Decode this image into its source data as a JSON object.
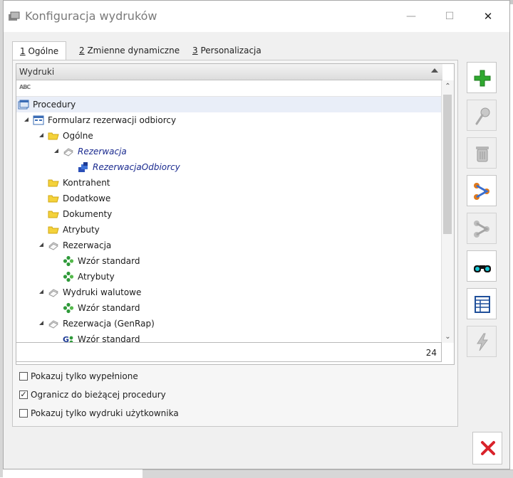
{
  "window": {
    "title": "Konfiguracja wydruków",
    "minimize_label": "—",
    "maximize_label": "☐",
    "close_label": "✕"
  },
  "tabs": [
    {
      "num": "1",
      "label": " Ogólne",
      "active": true
    },
    {
      "num": "2",
      "label": " Zmienne dynamiczne",
      "active": false
    },
    {
      "num": "3",
      "label": " Personalizacja",
      "active": false
    }
  ],
  "grid": {
    "header": "Wydruki",
    "filter_icon": "ABC",
    "rows": [
      {
        "label": "Procedury",
        "icon": "procedures-icon",
        "selected": true,
        "italic": false
      },
      {
        "label": "Formularz rezerwacji odbiorcy",
        "icon": "form-icon",
        "selected": false,
        "italic": false
      },
      {
        "label": "Ogólne",
        "icon": "folder-icon",
        "selected": false,
        "italic": false
      },
      {
        "label": "Rezerwacja",
        "icon": "document-icon",
        "selected": false,
        "italic": true
      },
      {
        "label": "RezerwacjaOdbiorcy",
        "icon": "blue-report-icon",
        "selected": false,
        "italic": true
      },
      {
        "label": "Kontrahent",
        "icon": "folder-icon",
        "selected": false,
        "italic": false
      },
      {
        "label": "Dodatkowe",
        "icon": "folder-icon",
        "selected": false,
        "italic": false
      },
      {
        "label": "Dokumenty",
        "icon": "folder-icon",
        "selected": false,
        "italic": false
      },
      {
        "label": "Atrybuty",
        "icon": "folder-icon",
        "selected": false,
        "italic": false
      },
      {
        "label": "Rezerwacja",
        "icon": "document-icon",
        "selected": false,
        "italic": false
      },
      {
        "label": "Wzór standard",
        "icon": "green-template-icon",
        "selected": false,
        "italic": false
      },
      {
        "label": "Atrybuty",
        "icon": "green-template-icon",
        "selected": false,
        "italic": false
      },
      {
        "label": "Wydruki walutowe",
        "icon": "document-icon",
        "selected": false,
        "italic": false
      },
      {
        "label": "Wzór standard",
        "icon": "green-template-icon",
        "selected": false,
        "italic": false
      },
      {
        "label": "Rezerwacja (GenRap)",
        "icon": "document-icon",
        "selected": false,
        "italic": false
      },
      {
        "label": "Wzór standard",
        "icon": "genrap-template-icon",
        "selected": false,
        "italic": false
      }
    ],
    "count": "24"
  },
  "options": [
    {
      "label": "Pokazuj tylko wypełnione",
      "checked": false
    },
    {
      "label": "Ogranicz do bieżącej procedury",
      "checked": true
    },
    {
      "label": "Pokazuj tylko wydruki użytkownika",
      "checked": false
    }
  ],
  "toolbar": [
    {
      "icon": "add-icon",
      "enabled": true
    },
    {
      "icon": "edit-icon",
      "enabled": false
    },
    {
      "icon": "delete-icon",
      "enabled": false
    },
    {
      "icon": "link-icon",
      "enabled": true
    },
    {
      "icon": "copy-link-icon",
      "enabled": false
    },
    {
      "icon": "binoculars-icon",
      "enabled": true
    },
    {
      "icon": "table-icon",
      "enabled": true
    },
    {
      "icon": "lightning-icon",
      "enabled": false
    }
  ],
  "colors": {
    "accent_green": "#2fa82f",
    "close_red": "#d9232b",
    "selected_row": "#e9eef8",
    "italic_link": "#1a2a8f"
  }
}
